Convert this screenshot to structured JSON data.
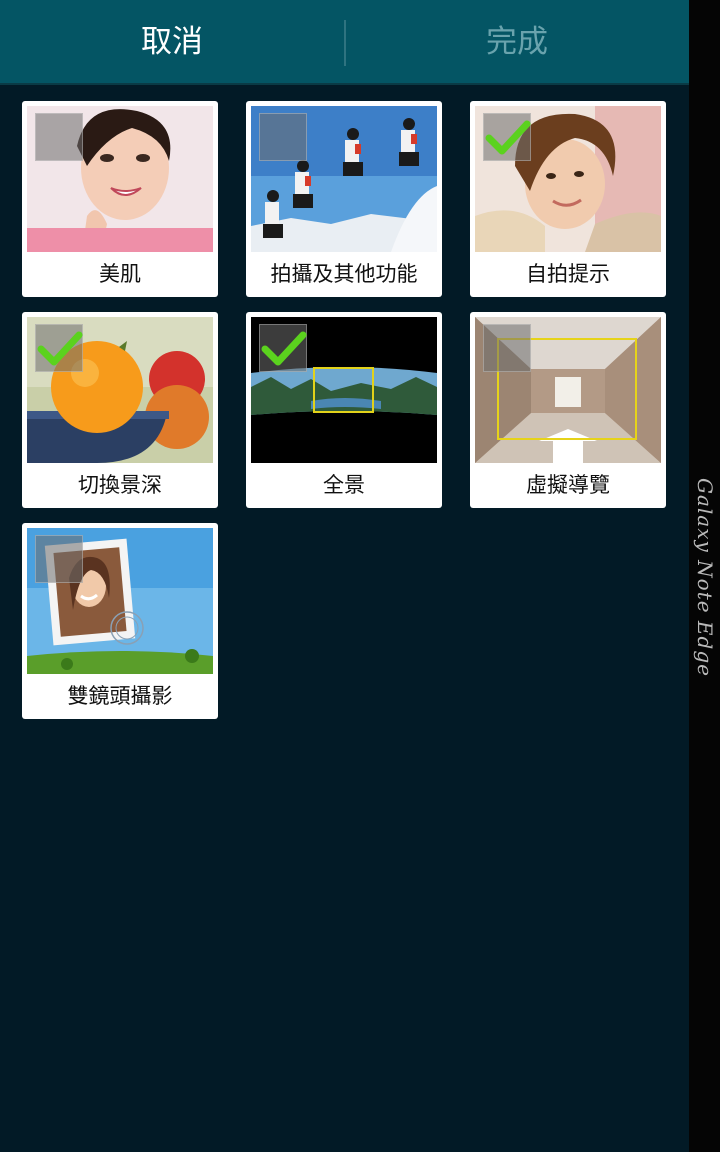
{
  "action_bar": {
    "cancel_label": "取消",
    "done_label": "完成"
  },
  "modes": [
    {
      "label": "美肌",
      "checked": false
    },
    {
      "label": "拍攝及其他功能",
      "checked": false
    },
    {
      "label": "自拍提示",
      "checked": true
    },
    {
      "label": "切換景深",
      "checked": true
    },
    {
      "label": "全景",
      "checked": true
    },
    {
      "label": "虛擬導覽",
      "checked": false
    },
    {
      "label": "雙鏡頭攝影",
      "checked": false
    }
  ],
  "device_edge_label": "Galaxy Note Edge",
  "colors": {
    "action_bar": "#045564",
    "background": "#021a26",
    "check": "#5bd21e"
  }
}
